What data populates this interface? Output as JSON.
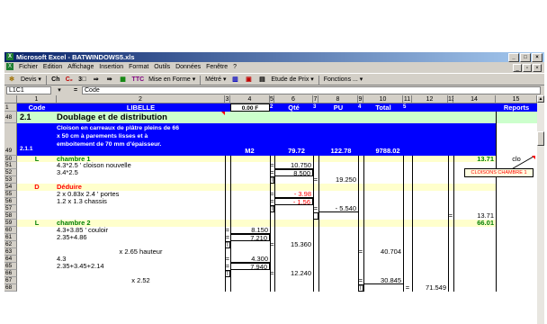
{
  "window": {
    "title": "Microsoft Excel - BATWINDOWS5.xls",
    "app_badge": "X",
    "controls": [
      "_",
      "□",
      "×"
    ]
  },
  "menu": {
    "items": [
      "Fichier",
      "Edition",
      "Affichage",
      "Insertion",
      "Format",
      "Outils",
      "Données",
      "Fenêtre",
      "?"
    ],
    "doc_controls": [
      "_",
      "▫",
      "×"
    ]
  },
  "toolbar": {
    "devis": "Devis ▾",
    "mise_en_forme": "Mise en Forme ▾",
    "metre": "Métré ▾",
    "etude_prix": "Etude de Prix ▾",
    "fonctions": "Fonctions ... ▾",
    "ttc": "TTC"
  },
  "formula": {
    "cell_ref": "L1C1",
    "eq": "=",
    "content": "Code"
  },
  "columns": [
    "1",
    "2",
    "3",
    "4",
    "5",
    "6",
    "7",
    "8",
    "9",
    "10",
    "11",
    "12",
    "13",
    "14",
    "15"
  ],
  "header_row": {
    "row": "1",
    "code": "Code",
    "libelle": "LIBELLE",
    "c4": "0.00 F",
    "c5": "2",
    "qte": "Qté",
    "c7": "3",
    "pu": "PU",
    "c9": "4",
    "total": "Total",
    "c11": "5",
    "reports": "Reports"
  },
  "rows": {
    "r48": {
      "num": "48",
      "code": "2.1",
      "libelle": "Doublage et de distribution"
    },
    "r49": {
      "num": "49",
      "code": "2.1.1",
      "libelle_lines": [
        "Cloison en carreaux de plâtre pleins de 66",
        "x 50 cm à parements lisses et à",
        "emboitement de 70 mm d'épaisseur."
      ],
      "unit": "M2",
      "qte": "79.72",
      "pu": "122.78",
      "total": "9788.02"
    },
    "r50": {
      "num": "50",
      "code": "L",
      "libelle": "chambre 1",
      "c14": "13.71",
      "c15": "clo"
    },
    "r51": {
      "num": "51",
      "libelle": "4.3*2.5 ' cloison nouvelle",
      "eq": "=",
      "qte": "10.750"
    },
    "r52": {
      "num": "52",
      "libelle": "3.4*2.5",
      "eq": "=",
      "qte": "8.500"
    },
    "r53": {
      "num": "53",
      "t": "T",
      "eq": "=",
      "pu": "19.250"
    },
    "r54": {
      "num": "54",
      "code": "D",
      "libelle": "Déduire"
    },
    "r55": {
      "num": "55",
      "libelle": "2 x 0.83x 2.4 ' portes",
      "eq": "=",
      "qte": "- 3.98"
    },
    "r56": {
      "num": "56",
      "libelle": "1.2 x 1.3 chassis",
      "eq": "=",
      "qte": "- 1.56"
    },
    "r57": {
      "num": "57",
      "t": "T",
      "eq": "=",
      "pu": "- 5.540"
    },
    "r58": {
      "num": "58",
      "eq": "=",
      "c14": "13.71"
    },
    "r59": {
      "num": "59",
      "code": "L",
      "libelle": "chambre 2",
      "c14": "66.01"
    },
    "r60": {
      "num": "60",
      "libelle": "4.3+3.85 ' couloir",
      "eq": "=",
      "c4": "8.150"
    },
    "r61": {
      "num": "61",
      "libelle": "2.35+4.86",
      "eq": "=",
      "c4": "7.210"
    },
    "r62": {
      "num": "62",
      "t": "T",
      "eq": "=",
      "qte": "15.360"
    },
    "r63": {
      "num": "63",
      "libelle": "x 2.65 hauteur",
      "eq": "=",
      "total": "40.704"
    },
    "r64": {
      "num": "64",
      "libelle": "4.3",
      "eq": "=",
      "c4": "4.300"
    },
    "r65": {
      "num": "65",
      "libelle": "2.35+3.45+2.14",
      "eq": "=",
      "c4": "7.940"
    },
    "r66": {
      "num": "66",
      "t": "T",
      "eq": "=",
      "qte": "12.240"
    },
    "r67": {
      "num": "67",
      "libelle": "x 2.52",
      "eq": "=",
      "total": "30.845"
    },
    "r68": {
      "num": "68",
      "t": "T",
      "eq": "=",
      "c12": "71.549"
    }
  },
  "comment": {
    "text": "CLOISONS CHAMBRE 1"
  }
}
